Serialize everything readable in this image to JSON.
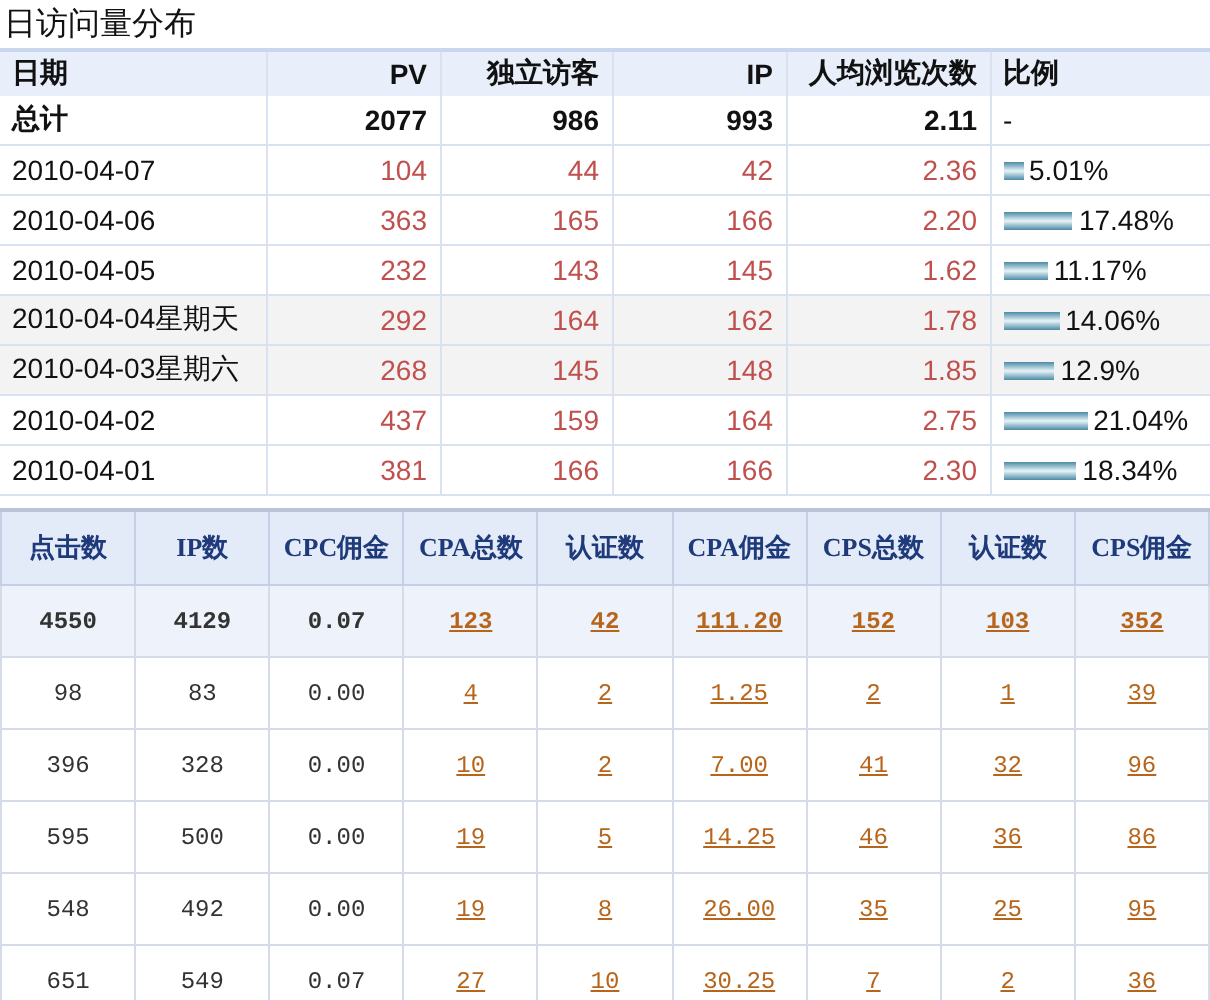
{
  "daily": {
    "title": "日访问量分布",
    "columns": [
      "日期",
      "PV",
      "独立访客",
      "IP",
      "人均浏览次数",
      "比例"
    ],
    "total": {
      "date": "总计",
      "pv": "2077",
      "visitors": "986",
      "ip": "993",
      "avg": "2.11",
      "ratio": "-"
    },
    "rows": [
      {
        "date": "2010-04-07",
        "pv": "104",
        "visitors": "44",
        "ip": "42",
        "avg": "2.36",
        "ratio": "5.01%",
        "level": 0.0501,
        "highlighted": false
      },
      {
        "date": "2010-04-06",
        "pv": "363",
        "visitors": "165",
        "ip": "166",
        "avg": "2.20",
        "ratio": "17.48%",
        "level": 0.1748,
        "highlighted": false
      },
      {
        "date": "2010-04-05",
        "pv": "232",
        "visitors": "143",
        "ip": "145",
        "avg": "1.62",
        "ratio": "11.17%",
        "level": 0.1117,
        "highlighted": false
      },
      {
        "date": "2010-04-04星期天",
        "pv": "292",
        "visitors": "164",
        "ip": "162",
        "avg": "1.78",
        "ratio": "14.06%",
        "level": 0.1406,
        "highlighted": true
      },
      {
        "date": "2010-04-03星期六",
        "pv": "268",
        "visitors": "145",
        "ip": "148",
        "avg": "1.85",
        "ratio": "12.9%",
        "level": 0.129,
        "highlighted": true
      },
      {
        "date": "2010-04-02",
        "pv": "437",
        "visitors": "159",
        "ip": "164",
        "avg": "2.75",
        "ratio": "21.04%",
        "level": 0.2104,
        "highlighted": false
      },
      {
        "date": "2010-04-01",
        "pv": "381",
        "visitors": "166",
        "ip": "166",
        "avg": "2.30",
        "ratio": "18.34%",
        "level": 0.1834,
        "highlighted": false
      }
    ]
  },
  "commission": {
    "columns": [
      {
        "label": "点击数",
        "kind": "text"
      },
      {
        "label": "IP数",
        "kind": "text"
      },
      {
        "label": "CPC佣金",
        "kind": "text"
      },
      {
        "label": "CPA总数",
        "kind": "link"
      },
      {
        "label": "认证数",
        "kind": "link"
      },
      {
        "label": "CPA佣金",
        "kind": "link"
      },
      {
        "label": "CPS总数",
        "kind": "link"
      },
      {
        "label": "认证数",
        "kind": "link"
      },
      {
        "label": "CPS佣金",
        "kind": "link"
      }
    ],
    "total": [
      "4550",
      "4129",
      "0.07",
      "123",
      "42",
      "111.20",
      "152",
      "103",
      "352"
    ],
    "rows": [
      [
        "98",
        "83",
        "0.00",
        "4",
        "2",
        "1.25",
        "2",
        "1",
        "39"
      ],
      [
        "396",
        "328",
        "0.00",
        "10",
        "2",
        "7.00",
        "41",
        "32",
        "96"
      ],
      [
        "595",
        "500",
        "0.00",
        "19",
        "5",
        "14.25",
        "46",
        "36",
        "86"
      ],
      [
        "548",
        "492",
        "0.00",
        "19",
        "8",
        "26.00",
        "35",
        "25",
        "95"
      ],
      [
        "651",
        "549",
        "0.07",
        "27",
        "10",
        "30.25",
        "7",
        "2",
        "36"
      ]
    ]
  }
}
